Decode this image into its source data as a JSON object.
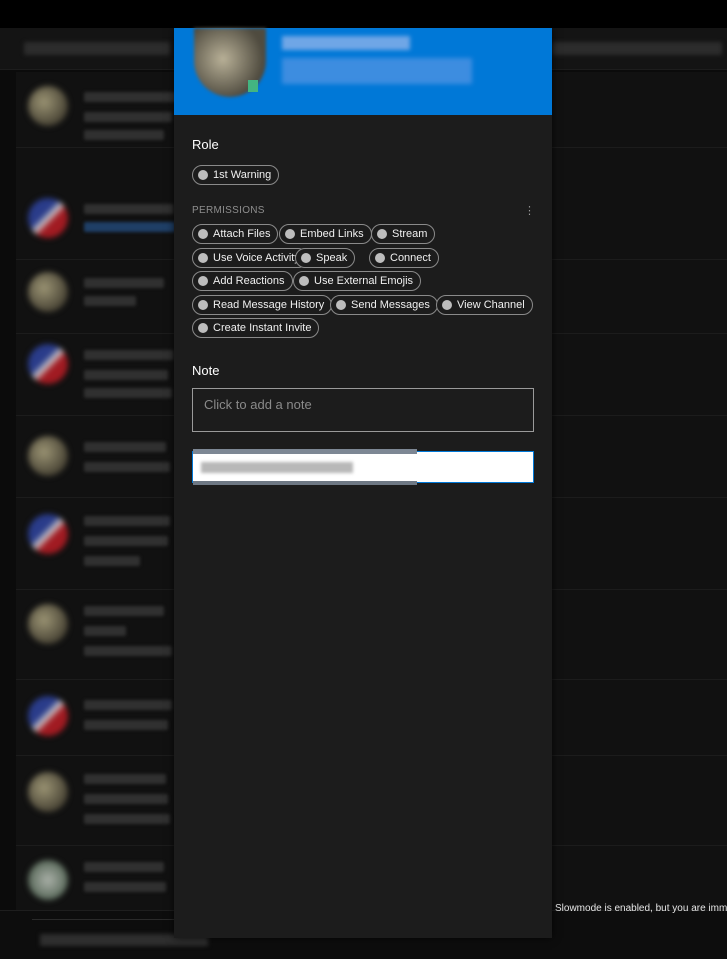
{
  "popout": {
    "role_title": "Role",
    "roles": [
      "1st Warning"
    ],
    "permissions_title": "PERMISSIONS",
    "permissions": [
      "Attach Files",
      "Embed Links",
      "Stream",
      "Use Voice Activity",
      "Speak",
      "Connect",
      "Add Reactions",
      "Use External Emojis",
      "Read Message History",
      "Send Messages",
      "View Channel",
      "Create Instant Invite"
    ],
    "more_icon": "⋮",
    "note_title": "Note",
    "note_placeholder": "Click to add a note",
    "status_color": "#43b581",
    "header_color": "#0078d7"
  },
  "chat": {
    "slowmode_notice": "Slowmode is enabled, but you are immu"
  }
}
